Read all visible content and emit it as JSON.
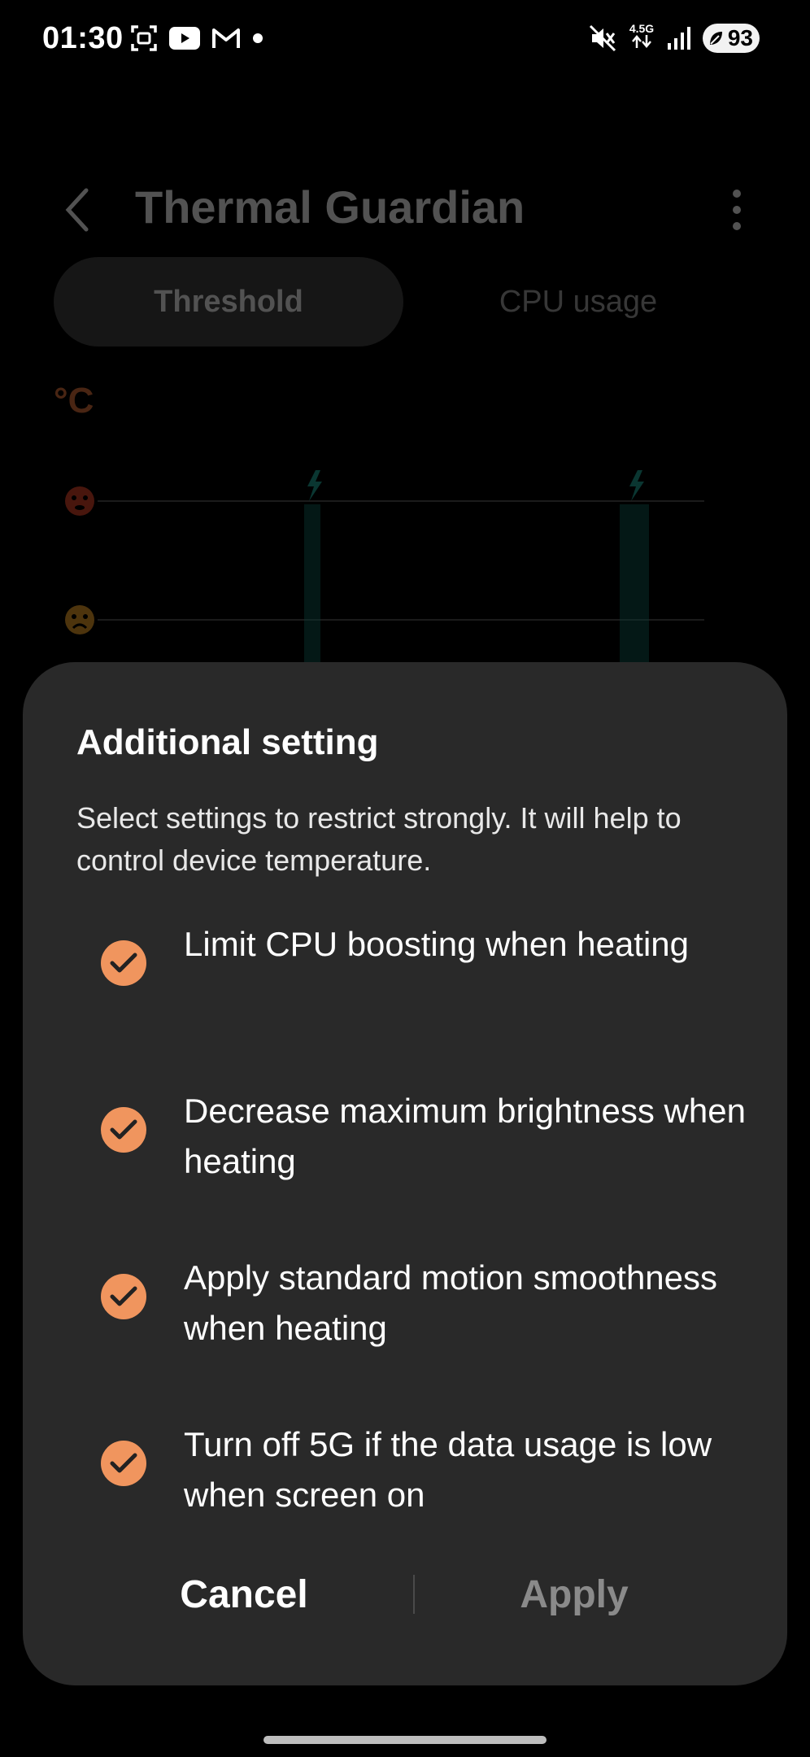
{
  "status_bar": {
    "time": "01:30",
    "left_icons": [
      "screenshot-icon",
      "youtube-icon",
      "gmail-icon",
      "dot-icon"
    ],
    "network_label": "4.5G",
    "battery_level": "93",
    "right_icons": [
      "mute-icon",
      "data-arrows-icon",
      "signal-icon",
      "battery-saver-icon"
    ]
  },
  "app": {
    "title": "Thermal Guardian",
    "tabs": [
      {
        "label": "Threshold",
        "active": true
      },
      {
        "label": "CPU usage",
        "active": false
      }
    ],
    "unit": "°C",
    "chart_level_icons": [
      "hot-face-icon",
      "worried-face-icon"
    ],
    "charging_markers": [
      "lightning-icon",
      "lightning-icon"
    ],
    "accent_color": "#e2743c",
    "chart_marker_color": "#1fa89a"
  },
  "sheet": {
    "title": "Additional setting",
    "description": "Select settings to restrict strongly. It will help to control device temperature.",
    "options": [
      {
        "label": "Limit CPU boosting when heating",
        "checked": true
      },
      {
        "label": "Decrease maximum brightness when heating",
        "checked": true
      },
      {
        "label": "Apply standard motion smoothness when heating",
        "checked": true
      },
      {
        "label": "Turn off 5G if the data usage is low when screen on",
        "checked": true
      }
    ],
    "cancel_label": "Cancel",
    "apply_label": "Apply",
    "check_color": "#f0955e",
    "background_color": "#292929"
  }
}
